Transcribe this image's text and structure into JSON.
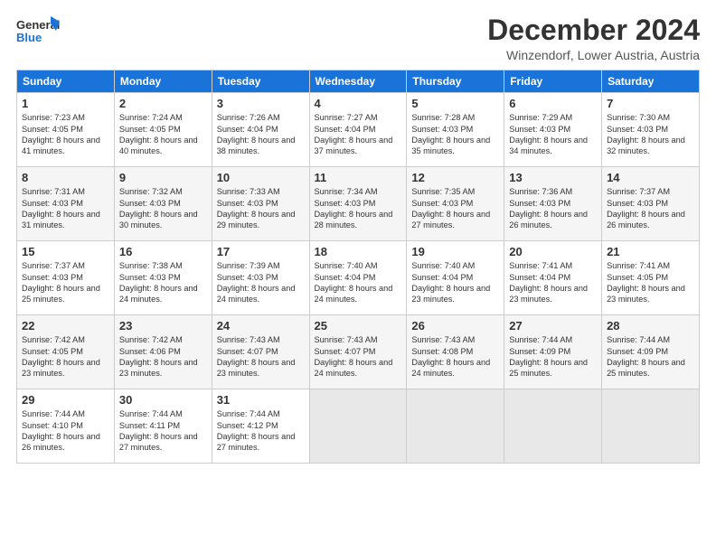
{
  "header": {
    "logo_general": "General",
    "logo_blue": "Blue",
    "month_title": "December 2024",
    "location": "Winzendorf, Lower Austria, Austria"
  },
  "weekdays": [
    "Sunday",
    "Monday",
    "Tuesday",
    "Wednesday",
    "Thursday",
    "Friday",
    "Saturday"
  ],
  "weeks": [
    [
      {
        "day": "1",
        "sunrise": "Sunrise: 7:23 AM",
        "sunset": "Sunset: 4:05 PM",
        "daylight": "Daylight: 8 hours and 41 minutes."
      },
      {
        "day": "2",
        "sunrise": "Sunrise: 7:24 AM",
        "sunset": "Sunset: 4:05 PM",
        "daylight": "Daylight: 8 hours and 40 minutes."
      },
      {
        "day": "3",
        "sunrise": "Sunrise: 7:26 AM",
        "sunset": "Sunset: 4:04 PM",
        "daylight": "Daylight: 8 hours and 38 minutes."
      },
      {
        "day": "4",
        "sunrise": "Sunrise: 7:27 AM",
        "sunset": "Sunset: 4:04 PM",
        "daylight": "Daylight: 8 hours and 37 minutes."
      },
      {
        "day": "5",
        "sunrise": "Sunrise: 7:28 AM",
        "sunset": "Sunset: 4:03 PM",
        "daylight": "Daylight: 8 hours and 35 minutes."
      },
      {
        "day": "6",
        "sunrise": "Sunrise: 7:29 AM",
        "sunset": "Sunset: 4:03 PM",
        "daylight": "Daylight: 8 hours and 34 minutes."
      },
      {
        "day": "7",
        "sunrise": "Sunrise: 7:30 AM",
        "sunset": "Sunset: 4:03 PM",
        "daylight": "Daylight: 8 hours and 32 minutes."
      }
    ],
    [
      {
        "day": "8",
        "sunrise": "Sunrise: 7:31 AM",
        "sunset": "Sunset: 4:03 PM",
        "daylight": "Daylight: 8 hours and 31 minutes."
      },
      {
        "day": "9",
        "sunrise": "Sunrise: 7:32 AM",
        "sunset": "Sunset: 4:03 PM",
        "daylight": "Daylight: 8 hours and 30 minutes."
      },
      {
        "day": "10",
        "sunrise": "Sunrise: 7:33 AM",
        "sunset": "Sunset: 4:03 PM",
        "daylight": "Daylight: 8 hours and 29 minutes."
      },
      {
        "day": "11",
        "sunrise": "Sunrise: 7:34 AM",
        "sunset": "Sunset: 4:03 PM",
        "daylight": "Daylight: 8 hours and 28 minutes."
      },
      {
        "day": "12",
        "sunrise": "Sunrise: 7:35 AM",
        "sunset": "Sunset: 4:03 PM",
        "daylight": "Daylight: 8 hours and 27 minutes."
      },
      {
        "day": "13",
        "sunrise": "Sunrise: 7:36 AM",
        "sunset": "Sunset: 4:03 PM",
        "daylight": "Daylight: 8 hours and 26 minutes."
      },
      {
        "day": "14",
        "sunrise": "Sunrise: 7:37 AM",
        "sunset": "Sunset: 4:03 PM",
        "daylight": "Daylight: 8 hours and 26 minutes."
      }
    ],
    [
      {
        "day": "15",
        "sunrise": "Sunrise: 7:37 AM",
        "sunset": "Sunset: 4:03 PM",
        "daylight": "Daylight: 8 hours and 25 minutes."
      },
      {
        "day": "16",
        "sunrise": "Sunrise: 7:38 AM",
        "sunset": "Sunset: 4:03 PM",
        "daylight": "Daylight: 8 hours and 24 minutes."
      },
      {
        "day": "17",
        "sunrise": "Sunrise: 7:39 AM",
        "sunset": "Sunset: 4:03 PM",
        "daylight": "Daylight: 8 hours and 24 minutes."
      },
      {
        "day": "18",
        "sunrise": "Sunrise: 7:40 AM",
        "sunset": "Sunset: 4:04 PM",
        "daylight": "Daylight: 8 hours and 24 minutes."
      },
      {
        "day": "19",
        "sunrise": "Sunrise: 7:40 AM",
        "sunset": "Sunset: 4:04 PM",
        "daylight": "Daylight: 8 hours and 23 minutes."
      },
      {
        "day": "20",
        "sunrise": "Sunrise: 7:41 AM",
        "sunset": "Sunset: 4:04 PM",
        "daylight": "Daylight: 8 hours and 23 minutes."
      },
      {
        "day": "21",
        "sunrise": "Sunrise: 7:41 AM",
        "sunset": "Sunset: 4:05 PM",
        "daylight": "Daylight: 8 hours and 23 minutes."
      }
    ],
    [
      {
        "day": "22",
        "sunrise": "Sunrise: 7:42 AM",
        "sunset": "Sunset: 4:05 PM",
        "daylight": "Daylight: 8 hours and 23 minutes."
      },
      {
        "day": "23",
        "sunrise": "Sunrise: 7:42 AM",
        "sunset": "Sunset: 4:06 PM",
        "daylight": "Daylight: 8 hours and 23 minutes."
      },
      {
        "day": "24",
        "sunrise": "Sunrise: 7:43 AM",
        "sunset": "Sunset: 4:07 PM",
        "daylight": "Daylight: 8 hours and 23 minutes."
      },
      {
        "day": "25",
        "sunrise": "Sunrise: 7:43 AM",
        "sunset": "Sunset: 4:07 PM",
        "daylight": "Daylight: 8 hours and 24 minutes."
      },
      {
        "day": "26",
        "sunrise": "Sunrise: 7:43 AM",
        "sunset": "Sunset: 4:08 PM",
        "daylight": "Daylight: 8 hours and 24 minutes."
      },
      {
        "day": "27",
        "sunrise": "Sunrise: 7:44 AM",
        "sunset": "Sunset: 4:09 PM",
        "daylight": "Daylight: 8 hours and 25 minutes."
      },
      {
        "day": "28",
        "sunrise": "Sunrise: 7:44 AM",
        "sunset": "Sunset: 4:09 PM",
        "daylight": "Daylight: 8 hours and 25 minutes."
      }
    ],
    [
      {
        "day": "29",
        "sunrise": "Sunrise: 7:44 AM",
        "sunset": "Sunset: 4:10 PM",
        "daylight": "Daylight: 8 hours and 26 minutes."
      },
      {
        "day": "30",
        "sunrise": "Sunrise: 7:44 AM",
        "sunset": "Sunset: 4:11 PM",
        "daylight": "Daylight: 8 hours and 27 minutes."
      },
      {
        "day": "31",
        "sunrise": "Sunrise: 7:44 AM",
        "sunset": "Sunset: 4:12 PM",
        "daylight": "Daylight: 8 hours and 27 minutes."
      },
      null,
      null,
      null,
      null
    ]
  ]
}
